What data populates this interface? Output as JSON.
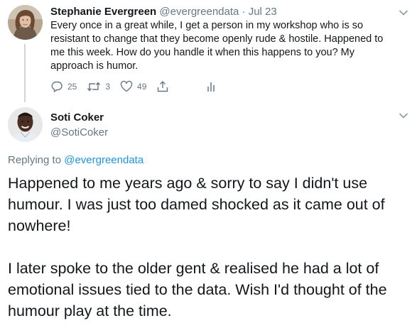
{
  "parent_tweet": {
    "display_name": "Stephanie Evergreen",
    "handle": "@evergreendata",
    "separator": " · ",
    "date": "Jul 23",
    "text": "Every once in a great while, I get a person in my workshop who is so resistant to change that they become openly rude & hostile. Happened to me this week. How do you handle it when this happens to you? My approach is humor.",
    "reply_count": "25",
    "retweet_count": "3",
    "like_count": "49",
    "icons": [
      "reply-icon",
      "retweet-icon",
      "like-icon",
      "share-icon",
      "analytics-icon",
      "chevron-down-icon"
    ]
  },
  "reply_tweet": {
    "display_name": "Soti Coker",
    "handle": "@SotiCoker",
    "replying_to_label": "Replying to",
    "replying_to_handle": "@evergreendata",
    "paragraph_1": "Happened to me years ago & sorry to say I didn't use humour. I was just too damed shocked as it came out of nowhere!",
    "paragraph_2": "I later spoke to the older gent & realised he had a lot of emotional issues tied to the data. Wish I'd thought of the humour play at the time."
  },
  "colors": {
    "text": "#14171a",
    "secondary": "#657786",
    "link": "#1b95e0",
    "divider": "#ccd6dd"
  }
}
